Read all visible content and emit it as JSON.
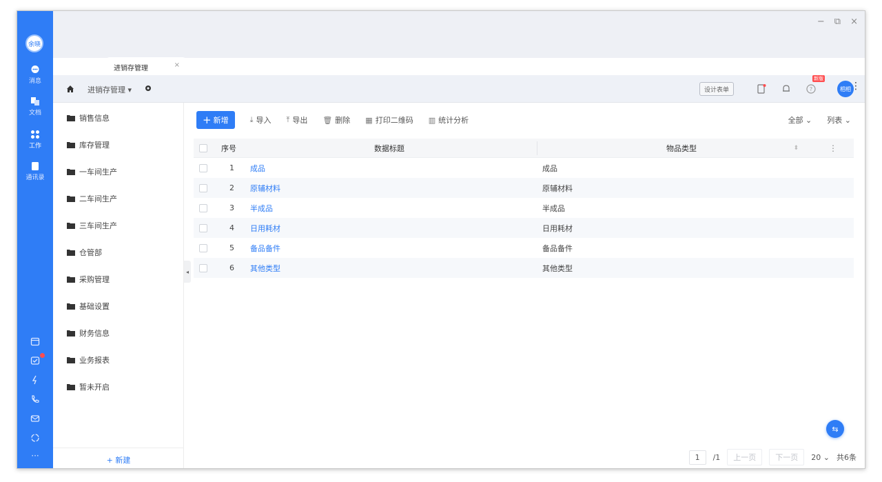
{
  "window": {
    "tab_title": "进销存管理",
    "tab_close": "×",
    "minimize": "−",
    "restore": "⧉",
    "close": "×"
  },
  "rail": {
    "avatar_text": "余晓",
    "items": [
      {
        "label": "消息",
        "icon": "chat-icon"
      },
      {
        "label": "文档",
        "icon": "document-icon"
      },
      {
        "label": "工作",
        "icon": "grid-icon"
      },
      {
        "label": "通讯录",
        "icon": "contacts-icon"
      }
    ]
  },
  "header": {
    "app_title": "进销存管理 ▾",
    "design_button": "设计表单",
    "hot_badge": "新版",
    "user_avatar_text": "相相"
  },
  "menu": {
    "items": [
      "销售信息",
      "库存管理",
      "一车间生产",
      "二车间生产",
      "三车间生产",
      "仓管部",
      "采购管理",
      "基础设置",
      "财务信息",
      "业务报表",
      "暂未开启"
    ],
    "footer_add": "+ 新建"
  },
  "actions": {
    "new": "新增",
    "import": "导入",
    "export": "导出",
    "delete": "删除",
    "print_qr": "打印二维码",
    "stats": "统计分析",
    "filter_all": "全部 ⌄",
    "view_list": "列表 ⌄"
  },
  "table": {
    "headers": {
      "no": "序号",
      "title": "数据标题",
      "type": "物品类型"
    },
    "rows": [
      {
        "no": "1",
        "title": "成品",
        "type": "成品"
      },
      {
        "no": "2",
        "title": "原辅材料",
        "type": "原辅材料"
      },
      {
        "no": "3",
        "title": "半成品",
        "type": "半成品"
      },
      {
        "no": "4",
        "title": "日用耗材",
        "type": "日用耗材"
      },
      {
        "no": "5",
        "title": "备品备件",
        "type": "备品备件"
      },
      {
        "no": "6",
        "title": "其他类型",
        "type": "其他类型"
      }
    ]
  },
  "pagination": {
    "current": "1",
    "total_pages": "/1",
    "prev": "上一页",
    "next": "下一页",
    "page_size": "20 ⌄",
    "total": "共6条"
  },
  "colors": {
    "brand": "#2f7df6",
    "link": "#2f7df6",
    "badge_red": "#ff4d4f"
  }
}
